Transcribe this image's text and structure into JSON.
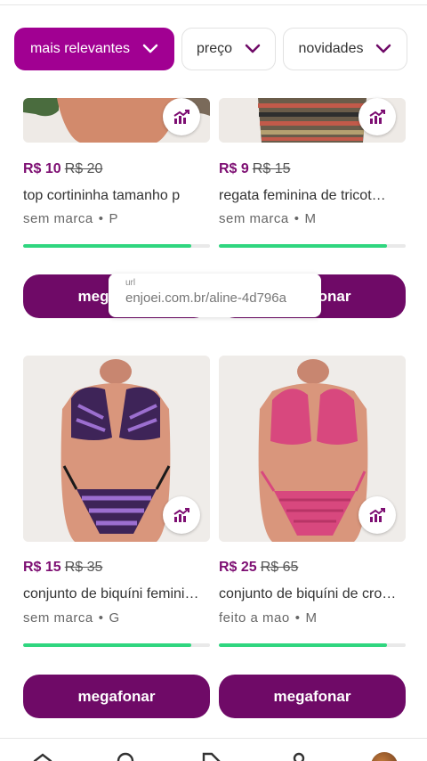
{
  "filters": [
    {
      "label": "mais relevantes",
      "active": true
    },
    {
      "label": "preço",
      "active": false
    },
    {
      "label": "novidades",
      "active": false
    }
  ],
  "products": [
    {
      "price": "R$ 10",
      "old_price": "R$ 20",
      "title": "top cortininha tamanho p",
      "brand": "sem  marca",
      "size": "P",
      "progress": 0.9,
      "button": "megafonar"
    },
    {
      "price": "R$ 9",
      "old_price": "R$ 15",
      "title": "regata feminina de tricot…",
      "brand": "sem  marca",
      "size": "M",
      "progress": 0.9,
      "button": "megafonar"
    },
    {
      "price": "R$ 15",
      "old_price": "R$ 35",
      "title": "conjunto de biquíni femini…",
      "brand": "sem  marca",
      "size": "G",
      "progress": 0.9,
      "button": "megafonar"
    },
    {
      "price": "R$ 25",
      "old_price": "R$ 65",
      "title": "conjunto de biquíni de cro…",
      "brand": "feito a mao",
      "size": "M",
      "progress": 0.9,
      "button": "megafonar"
    }
  ],
  "tooltip": {
    "label": "url",
    "value": "enjoei.com.br/aline-4d796a"
  },
  "colors": {
    "brand_purple": "#a10092",
    "button_purple": "#6f0a67",
    "price_purple": "#7d0e72",
    "progress_green": "#2fd67f"
  },
  "icons": {
    "stats": "trending-chart-icon",
    "chevron": "chevron-down-icon",
    "nav": [
      "home-icon",
      "search-icon",
      "tag-icon",
      "profile-icon"
    ]
  }
}
